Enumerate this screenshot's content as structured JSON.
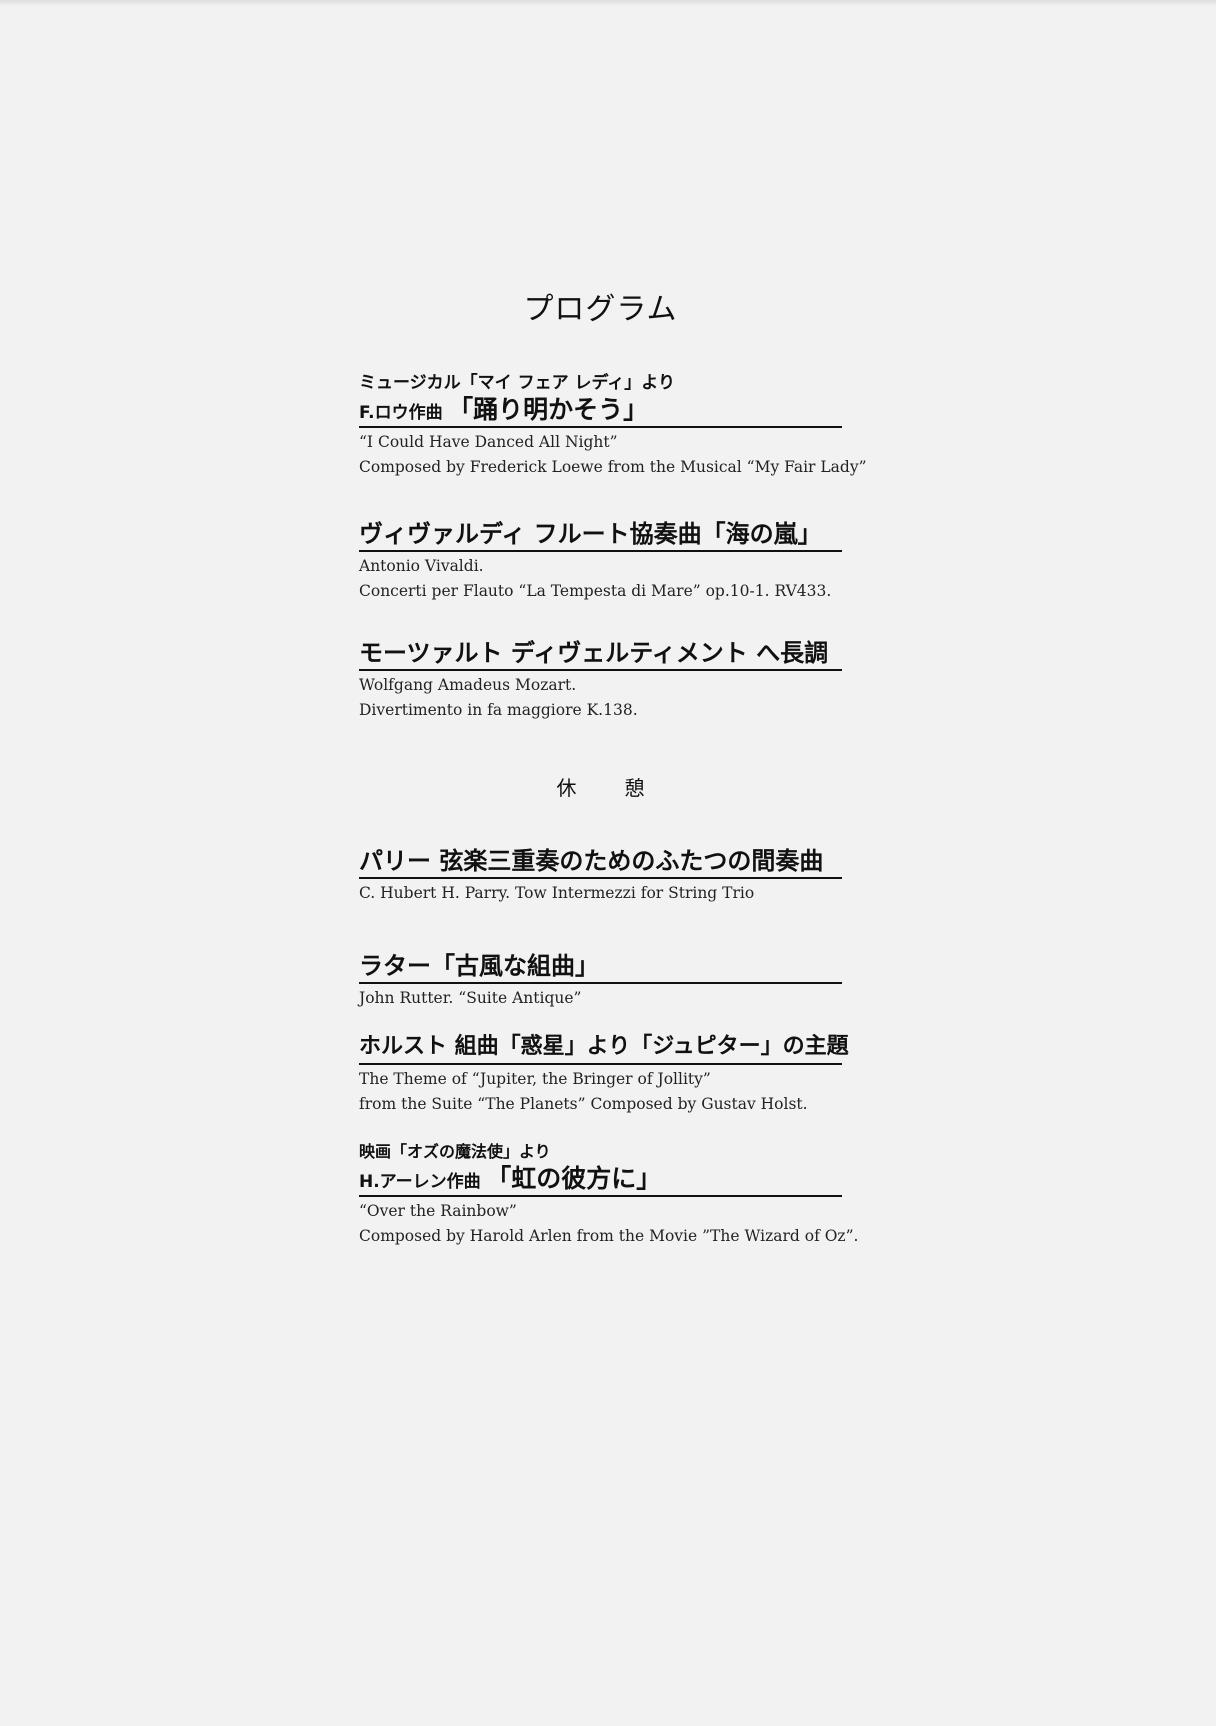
{
  "title": "プログラム",
  "intermission": "休　憩",
  "pieces": [
    {
      "sub": "ミュージカル「マイ フェア レディ」より",
      "heading_small": "F.ロウ作曲",
      "heading_big": "「踊り明かそう」",
      "en": [
        "“I Could Have Danced All Night”",
        "Composed by Frederick Loewe from the Musical “My Fair Lady”"
      ]
    },
    {
      "heading_big": "ヴィヴァルディ フルート協奏曲「海の嵐」",
      "en": [
        "Antonio Vivaldi.",
        "Concerti per Flauto “La Tempesta di Mare” op.10-1. RV433."
      ]
    },
    {
      "heading_big": "モーツァルト ディヴェルティメント へ長調",
      "en": [
        "Wolfgang Amadeus Mozart.",
        "Divertimento in fa maggiore K.138."
      ]
    },
    {
      "heading_big": "パリー 弦楽三重奏のためのふたつの間奏曲",
      "en": [
        "C. Hubert H. Parry. Tow Intermezzi for String Trio"
      ]
    },
    {
      "heading_big": "ラター「古風な組曲」",
      "en": [
        "John Rutter. “Suite Antique”"
      ]
    },
    {
      "heading_big": "ホルスト 組曲「惑星」より「ジュピター」の主題",
      "en": [
        "The Theme of “Jupiter, the Bringer of Jollity”",
        "from the Suite “The Planets” Composed by Gustav Holst."
      ]
    },
    {
      "sub": "映画「オズの魔法使」より",
      "heading_small": "H.アーレン作曲",
      "heading_big": "「虹の彼方に」",
      "en": [
        "“Over the Rainbow”",
        "Composed by Harold Arlen from the Movie ”The Wizard of Oz”."
      ]
    }
  ]
}
